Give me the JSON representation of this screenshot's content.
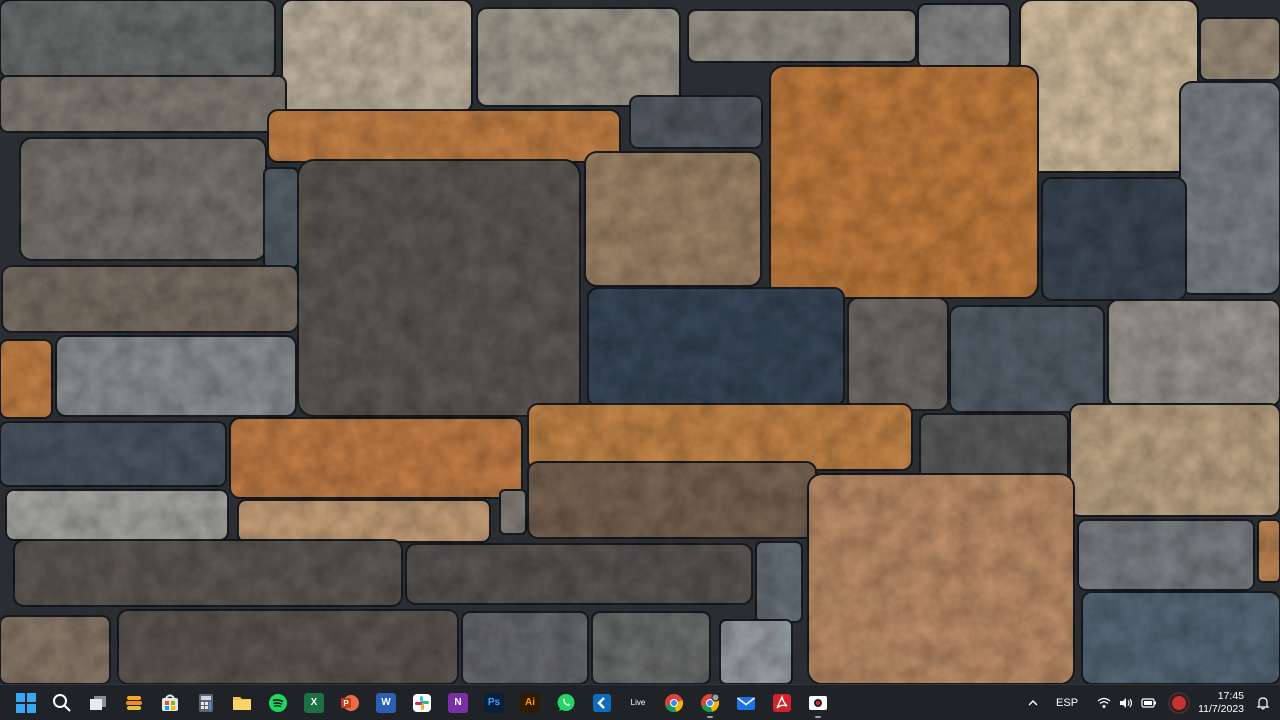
{
  "desktop": {
    "wallpaper": "stone-wall"
  },
  "taskbar": {
    "apps": [
      {
        "name": "start-button",
        "icon": "windows-logo-icon",
        "running": false
      },
      {
        "name": "search-button",
        "icon": "search-icon",
        "running": false
      },
      {
        "name": "task-view-button",
        "icon": "task-view-icon",
        "running": false
      },
      {
        "name": "app-stack",
        "icon": "stack-app-icon",
        "running": false
      },
      {
        "name": "app-store",
        "icon": "store-icon",
        "running": false
      },
      {
        "name": "app-calculator",
        "icon": "calculator-icon",
        "running": false
      },
      {
        "name": "app-file-explorer",
        "icon": "folder-icon",
        "running": false
      },
      {
        "name": "app-spotify",
        "icon": "spotify-icon",
        "running": false
      },
      {
        "name": "app-excel",
        "icon": "excel-icon",
        "running": false
      },
      {
        "name": "app-powerpoint",
        "icon": "powerpoint-icon",
        "running": false
      },
      {
        "name": "app-word",
        "icon": "word-icon",
        "running": false
      },
      {
        "name": "app-slack",
        "icon": "slack-icon",
        "running": false
      },
      {
        "name": "app-onenote",
        "icon": "onenote-icon",
        "running": false
      },
      {
        "name": "app-photoshop",
        "icon": "photoshop-icon",
        "label": "Ps",
        "running": false
      },
      {
        "name": "app-illustrator",
        "icon": "illustrator-icon",
        "label": "Ai",
        "running": false
      },
      {
        "name": "app-whatsapp",
        "icon": "whatsapp-icon",
        "running": false
      },
      {
        "name": "app-kanban",
        "icon": "kanban-icon",
        "running": false
      },
      {
        "name": "app-ableton-live",
        "icon": "ableton-live-icon",
        "label": "Live",
        "running": false
      },
      {
        "name": "app-chrome",
        "icon": "chrome-icon",
        "running": false
      },
      {
        "name": "app-chrome-profile",
        "icon": "chrome-profile-icon",
        "running": true
      },
      {
        "name": "app-mail",
        "icon": "mail-icon",
        "running": false
      },
      {
        "name": "app-acrobat",
        "icon": "acrobat-icon",
        "running": false
      },
      {
        "name": "app-recorder",
        "icon": "recorder-icon",
        "running": true
      }
    ],
    "tray": {
      "language": "ESP",
      "time": "17:45",
      "date": "11/7/2023"
    }
  }
}
